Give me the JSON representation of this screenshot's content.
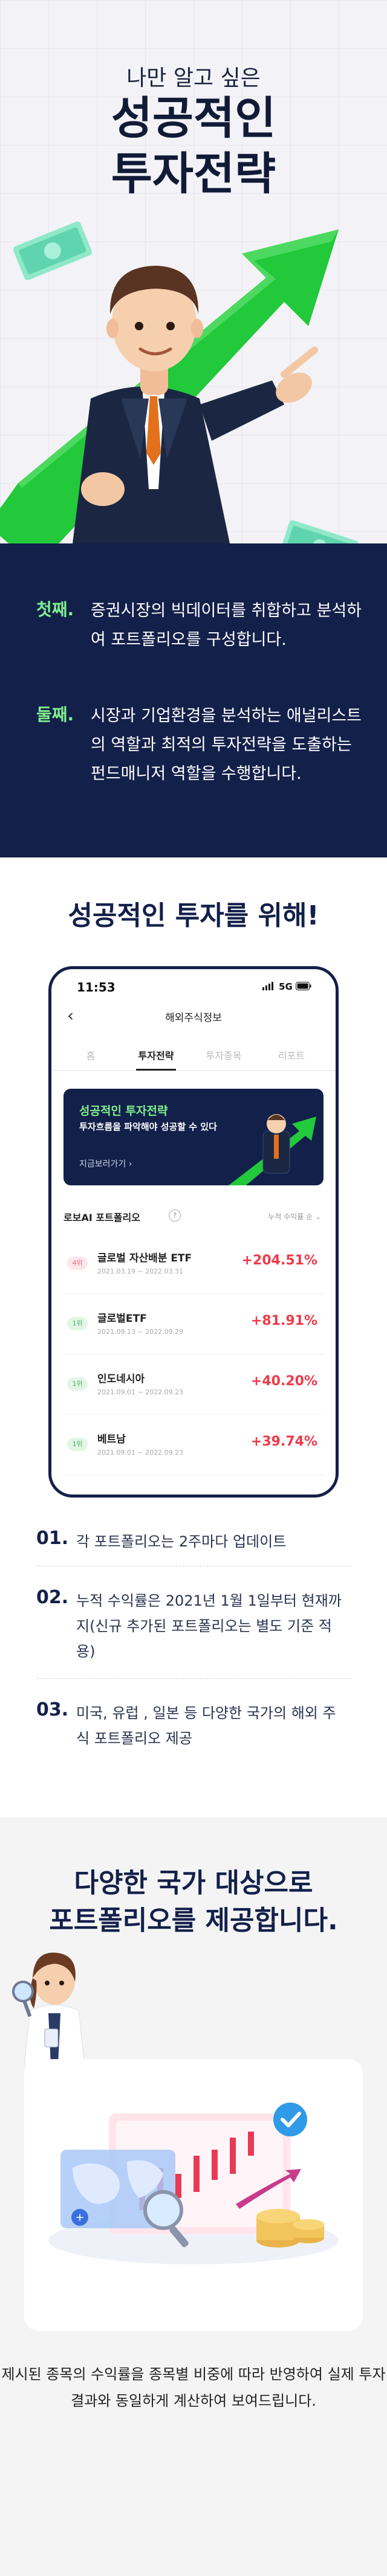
{
  "hero": {
    "subtitle": "나만 알고 싶은",
    "title_line1": "성공적인",
    "title_line2": "투자전략"
  },
  "points": [
    {
      "label": "첫째.",
      "text": "증권시장의 빅데이터를 취합하고 분석하여 포트폴리오를 구성합니다."
    },
    {
      "label": "둘째.",
      "text": "시장과 기업환경을 분석하는 애널리스트의 역할과 최적의 투자전략을 도출하는 펀드매니저 역할을 수행합니다."
    }
  ],
  "section2": {
    "title": "성공적인 투자를 위해!",
    "phone": {
      "time": "11:53",
      "network": "5G",
      "screen_title": "해외주식정보",
      "tabs": [
        "홈",
        "투자전략",
        "투자종목",
        "리포트"
      ],
      "active_tab": 1,
      "banner": {
        "title": "성공적인 투자전략",
        "subtitle": "투자흐름을 파악해야 성공할 수 있다",
        "link": "지금보러가기"
      },
      "portfolio_title": "로보AI 포트폴리오",
      "sort_label": "누적 수익률 순",
      "rows": [
        {
          "rank": "4위",
          "name": "글로벌 자산배분 ETF",
          "date": "2021.03.19 ~ 2022.03.31",
          "rate": "+204.51%",
          "rank_color": "#ffe6ea",
          "rank_text": "#ef6a7a"
        },
        {
          "rank": "1위",
          "name": "글로벌ETF",
          "date": "2021.09.13 ~ 2022.09.29",
          "rate": "+81.91%",
          "rank_color": "#e3f6e6",
          "rank_text": "#4caf66"
        },
        {
          "rank": "1위",
          "name": "인도네시아",
          "date": "2021.09.01 ~ 2022.09.23",
          "rate": "+40.20%",
          "rank_color": "#e3f6e6",
          "rank_text": "#4caf66"
        },
        {
          "rank": "1위",
          "name": "베트남",
          "date": "2021.09.01 ~ 2022.09.23",
          "rate": "+39.74%",
          "rank_color": "#e3f6e6",
          "rank_text": "#4caf66"
        }
      ]
    },
    "notes": [
      {
        "no": "01.",
        "text": "각 포트폴리오는 2주마다 업데이트"
      },
      {
        "no": "02.",
        "text": "누적 수익률은 2021년 1월 1일부터 현재까지(신규 추가된 포트폴리오는 별도 기준 적용)"
      },
      {
        "no": "03.",
        "text": "미국, 유럽 , 일본 등 다양한 국가의 해외 주식 포트폴리오 제공"
      }
    ]
  },
  "section3": {
    "title_line1": "다양한 국가 대상으로",
    "title_line2": "포트폴리오를 제공합니다.",
    "footer": "제시된 종목의 수익률을 종목별 비중에 따라 반영하여 실제 투자 결과와 동일하게 계산하여 보여드립니다."
  },
  "colors": {
    "navy": "#13204a",
    "accent_green": "#7ff08e",
    "rate_red": "#ef3b4a",
    "arrow_green": "#22c93b"
  },
  "icons": [
    "money-bill-icon",
    "rising-arrow-icon",
    "back-arrow-icon",
    "signal-icon",
    "battery-icon",
    "info-icon",
    "check-badge-icon",
    "magnifier-icon",
    "globe-map-icon",
    "coin-stack-icon"
  ]
}
